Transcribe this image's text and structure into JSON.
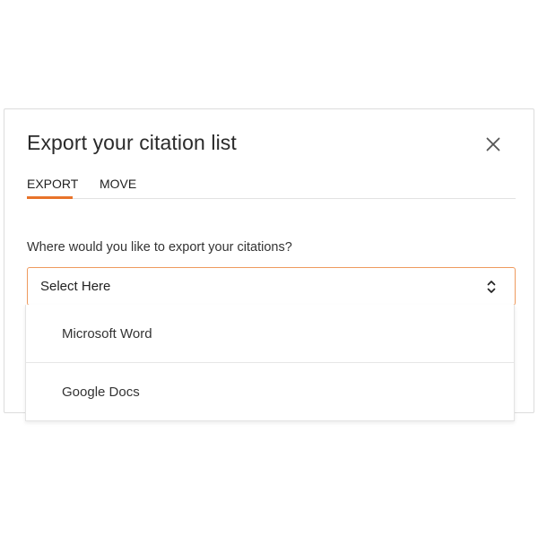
{
  "modal": {
    "title": "Export your citation list",
    "close_icon": "close-icon"
  },
  "tabs": [
    {
      "label": "EXPORT",
      "active": true
    },
    {
      "label": "MOVE",
      "active": false
    }
  ],
  "form": {
    "prompt": "Where would you like to export your citations?",
    "select_value": "Select Here",
    "select_icon": "chevron-up-down-icon"
  },
  "dropdown": {
    "options": [
      {
        "label": "Microsoft Word"
      },
      {
        "label": "Google Docs"
      }
    ]
  },
  "colors": {
    "accent": "#e8732a",
    "focus_border": "#ee9a5e"
  }
}
